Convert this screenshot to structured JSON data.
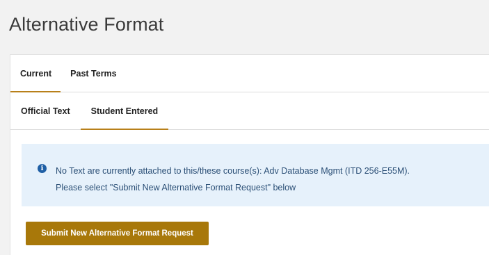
{
  "page": {
    "title": "Alternative Format"
  },
  "tabs_primary": [
    {
      "label": "Current",
      "active": true
    },
    {
      "label": "Past Terms",
      "active": false
    }
  ],
  "tabs_secondary": [
    {
      "label": "Official Text",
      "active": false
    },
    {
      "label": "Student Entered",
      "active": true
    }
  ],
  "alert": {
    "icon": "info-icon",
    "line1": "No Text are currently attached to this/these course(s): Adv Database Mgmt (ITD 256-E55M).",
    "line2": "Please select \"Submit New Alternative Format Request\" below"
  },
  "actions": {
    "submit_label": "Submit New Alternative Format Request"
  },
  "colors": {
    "accent": "#b8801a",
    "button": "#a8780a",
    "alert_bg": "#e6f1fb",
    "alert_text": "#2b4f76"
  }
}
